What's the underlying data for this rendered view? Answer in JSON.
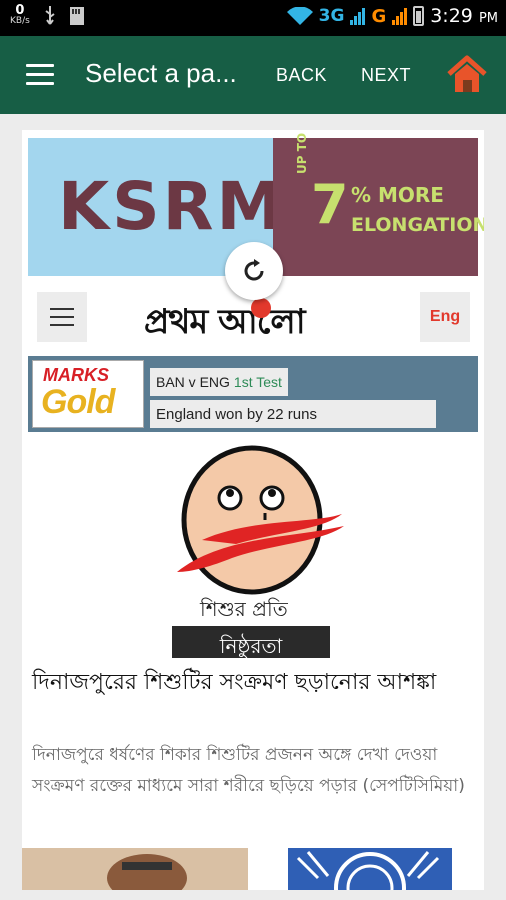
{
  "status_bar": {
    "speed_value": "0",
    "speed_unit": "KB/s",
    "network_3g": "3G",
    "network_g": "G",
    "time": "3:29",
    "ampm": "PM"
  },
  "app_bar": {
    "title": "Select a pa...",
    "back_label": "BACK",
    "next_label": "NEXT",
    "color": "#175e45"
  },
  "ad": {
    "brand": "KSRM",
    "upto": "UP TO",
    "percent": "7",
    "more": "% MORE",
    "elongation": "ELONGATION"
  },
  "site": {
    "logo_text": "প্রথম আলো",
    "lang_button": "Eng"
  },
  "score": {
    "sponsor_line1": "MARKS",
    "sponsor_line2": "Gold",
    "match": "BAN v ENG",
    "match_sub": "1st Test",
    "result": "England won by 22 runs"
  },
  "illustration": {
    "caption": "শিশুর প্রতি",
    "band_text": "নিষ্ঠুরতা"
  },
  "article": {
    "headline": "দিনাজপুরের শিশুটির সংক্রমণ ছড়ানোর আশঙ্কা",
    "summary": "দিনাজপুরে ধর্ষণের শিকার শিশুটির প্রজনন অঙ্গে দেখা দেওয়া সংক্রমণ রক্তের মাধ্যমে সারা শরীরে ছড়িয়ে পড়ার (সেপটিসিমিয়া)"
  }
}
